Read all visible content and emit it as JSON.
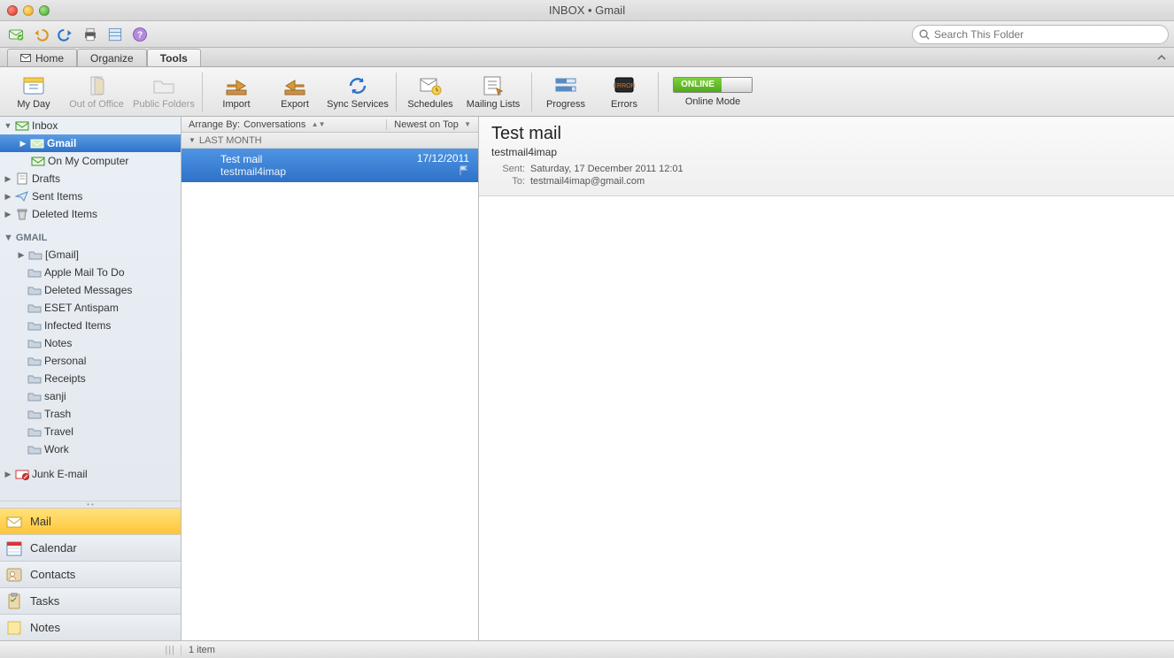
{
  "window": {
    "title": "INBOX • Gmail"
  },
  "search": {
    "placeholder": "Search This Folder"
  },
  "tabs": {
    "items": [
      "Home",
      "Organize",
      "Tools"
    ],
    "active": 2
  },
  "ribbon": {
    "buttons": [
      {
        "label": "My Day"
      },
      {
        "label": "Out of Office",
        "disabled": true
      },
      {
        "label": "Public Folders",
        "disabled": true
      },
      {
        "label": "Import"
      },
      {
        "label": "Export"
      },
      {
        "label": "Sync Services"
      },
      {
        "label": "Schedules"
      },
      {
        "label": "Mailing Lists"
      },
      {
        "label": "Progress"
      },
      {
        "label": "Errors"
      }
    ],
    "online": {
      "label": "Online Mode",
      "pill": "ONLINE"
    }
  },
  "sidebar": {
    "inbox": {
      "label": "Inbox",
      "children": [
        "Gmail",
        "On My Computer"
      ],
      "selectedChild": 0
    },
    "drafts": "Drafts",
    "sent": "Sent Items",
    "deleted": "Deleted Items",
    "gmailSection": "GMAIL",
    "gmailFolders": [
      "[Gmail]",
      "Apple Mail To Do",
      "Deleted Messages",
      "ESET Antispam",
      "Infected Items",
      "Notes",
      "Personal",
      "Receipts",
      "sanji",
      "Trash",
      "Travel",
      "Work"
    ],
    "junk": "Junk E-mail",
    "nav": [
      "Mail",
      "Calendar",
      "Contacts",
      "Tasks",
      "Notes"
    ],
    "navSelected": 0
  },
  "list": {
    "arrangeByLabel": "Arrange By:",
    "arrangeByValue": "Conversations",
    "sortLabel": "Newest on Top",
    "groupHeader": "LAST MONTH",
    "messages": [
      {
        "subject": "Test mail",
        "from": "testmail4imap",
        "date": "17/12/2011",
        "selected": true
      }
    ]
  },
  "preview": {
    "subject": "Test mail",
    "sender": "testmail4imap",
    "sentLabel": "Sent:",
    "sentValue": "Saturday, 17 December 2011 12:01",
    "toLabel": "To:",
    "toValue": "testmail4imap@gmail.com"
  },
  "status": {
    "text": "1 item"
  }
}
